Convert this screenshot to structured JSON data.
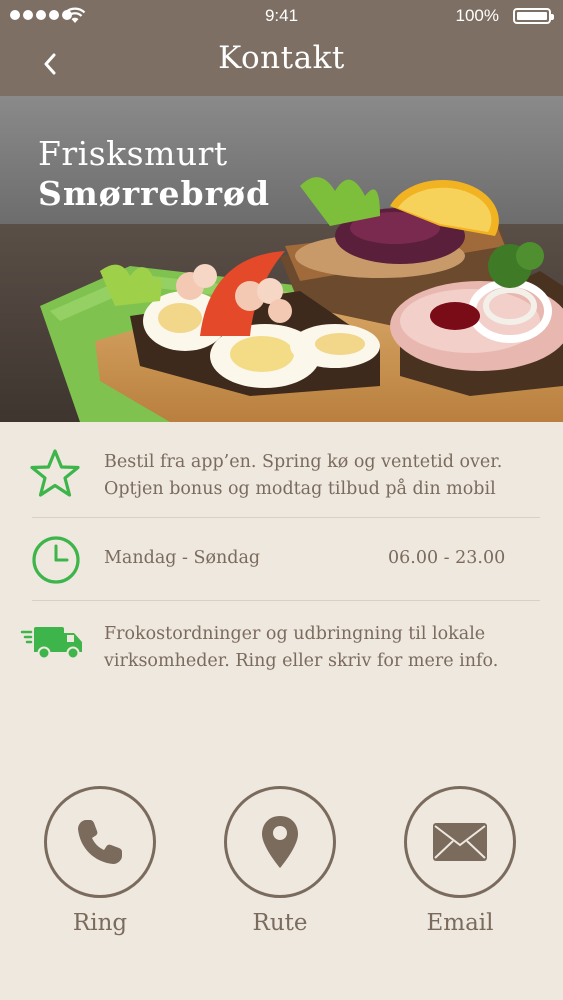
{
  "status_bar": {
    "time": "9:41",
    "battery": "100%"
  },
  "nav": {
    "title": "Kontakt",
    "back_icon": "chevron-left-icon"
  },
  "hero": {
    "line1": "Frisksmurt",
    "line2": "Smørrebrød"
  },
  "info": [
    {
      "icon": "star-icon",
      "text_lines": [
        "Bestil fra app’en. Spring kø og ventetid over.",
        "Optjen bonus og modtag tilbud på din mobil"
      ]
    },
    {
      "icon": "clock-icon",
      "days": "Mandag - Søndag",
      "hours": "06.00 - 23.00"
    },
    {
      "icon": "delivery-truck-icon",
      "text_lines": [
        "Frokostordninger og udbringning til lokale",
        "virksomheder. Ring eller skriv for mere info."
      ]
    }
  ],
  "actions": [
    {
      "icon": "phone-icon",
      "label": "Ring"
    },
    {
      "icon": "map-pin-icon",
      "label": "Rute"
    },
    {
      "icon": "envelope-icon",
      "label": "Email"
    }
  ],
  "colors": {
    "nav_bg": "#7d6f63",
    "page_bg": "#efe8df",
    "accent_green": "#3db54a",
    "text_brown": "#7a6b5d"
  }
}
